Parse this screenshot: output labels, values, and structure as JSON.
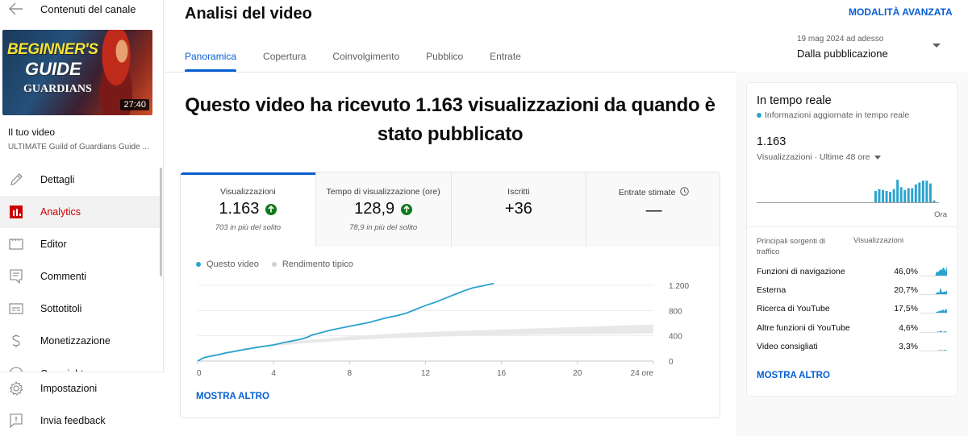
{
  "sidebar": {
    "back_label": "Contenuti del canale",
    "thumbnail": {
      "title_line1": "BEGINNER'S",
      "title_line2": "GUIDE",
      "title_line3": "GUARDIANS",
      "duration": "27:40"
    },
    "your_video_label": "Il tuo video",
    "video_title": "ULTIMATE Guild of Guardians Guide ...",
    "nav_items": [
      {
        "label": "Dettagli",
        "icon": "pencil-icon",
        "active": false
      },
      {
        "label": "Analytics",
        "icon": "analytics-icon",
        "active": true
      },
      {
        "label": "Editor",
        "icon": "editor-icon",
        "active": false
      },
      {
        "label": "Commenti",
        "icon": "comments-icon",
        "active": false
      },
      {
        "label": "Sottotitoli",
        "icon": "subtitles-icon",
        "active": false
      },
      {
        "label": "Monetizzazione",
        "icon": "dollar-icon",
        "active": false
      },
      {
        "label": "Copyright",
        "icon": "copyright-icon",
        "active": false
      }
    ],
    "bottom_items": [
      {
        "label": "Impostazioni",
        "icon": "gear-icon"
      },
      {
        "label": "Invia feedback",
        "icon": "feedback-icon"
      }
    ]
  },
  "header": {
    "title": "Analisi del video",
    "advanced_mode": "MODALITÀ AVANZATA",
    "date_range": "19 mag 2024 ad adesso",
    "date_preset": "Dalla pubblicazione"
  },
  "tabs": [
    {
      "label": "Panoramica",
      "active": true
    },
    {
      "label": "Copertura",
      "active": false
    },
    {
      "label": "Coinvolgimento",
      "active": false
    },
    {
      "label": "Pubblico",
      "active": false
    },
    {
      "label": "Entrate",
      "active": false
    }
  ],
  "headline": "Questo video ha ricevuto 1.163 visualizzazioni da quando è stato pubblicato",
  "metrics": [
    {
      "label": "Visualizzazioni",
      "value": "1.163",
      "trend": "up",
      "sub": "703 in più del solito",
      "active": true
    },
    {
      "label": "Tempo di visualizzazione (ore)",
      "value": "128,9",
      "trend": "up",
      "sub": "78,9 in più del solito",
      "active": false
    },
    {
      "label": "Iscritti",
      "value": "+36",
      "trend": null,
      "sub": "",
      "active": false
    },
    {
      "label": "Entrate stimate",
      "value": "—",
      "trend": null,
      "sub": "",
      "active": false,
      "has_clock_icon": true
    }
  ],
  "show_more": "MOSTRA ALTRO",
  "colors": {
    "accent": "#065fd4",
    "active_nav": "#cc0000",
    "series": "#2ba3cf",
    "typical_band": "#e8e8e8",
    "trend_up": "#0f7a1a"
  },
  "chart_data": {
    "type": "line",
    "title": "",
    "xlabel": "",
    "ylabel": "",
    "x_ticks": [
      "0",
      "4",
      "8",
      "12",
      "16",
      "20",
      "24 ore"
    ],
    "y_ticks": [
      "0",
      "400",
      "800",
      "1.200"
    ],
    "xlim": [
      0,
      24
    ],
    "ylim": [
      0,
      1200
    ],
    "legend": [
      "Questo video",
      "Rendimento tipico"
    ],
    "legend_position": "top-left",
    "grid": true,
    "series": [
      {
        "name": "Questo video",
        "x": [
          0,
          0.3,
          0.7,
          1,
          1.5,
          2,
          2.5,
          3,
          3.5,
          4,
          4.5,
          5,
          5.5,
          5.8,
          6,
          6.5,
          7,
          7.5,
          8,
          8.5,
          9,
          9.5,
          10,
          10.5,
          11,
          11.5,
          12,
          12.5,
          13,
          13.5,
          14,
          14.5,
          15,
          15.6
        ],
        "y": [
          0,
          50,
          80,
          95,
          130,
          155,
          185,
          210,
          235,
          255,
          290,
          320,
          350,
          380,
          410,
          450,
          490,
          520,
          550,
          580,
          610,
          650,
          690,
          720,
          760,
          820,
          880,
          930,
          990,
          1050,
          1110,
          1160,
          1190,
          1230
        ]
      },
      {
        "name": "Rendimento tipico",
        "type": "band",
        "x": [
          0,
          2,
          4,
          6,
          8,
          10,
          12,
          14,
          16,
          18,
          20,
          22,
          24
        ],
        "low": [
          0,
          160,
          240,
          290,
          330,
          360,
          380,
          400,
          410,
          420,
          425,
          430,
          440
        ],
        "high": [
          0,
          180,
          270,
          340,
          390,
          430,
          460,
          480,
          500,
          520,
          540,
          560,
          580
        ]
      }
    ]
  },
  "realtime": {
    "title": "In tempo reale",
    "subtitle": "Informazioni aggiornate in tempo reale",
    "value": "1.163",
    "metric_label": "Visualizzazioni · Ultime 48 ore",
    "bar_end_label": "Ora",
    "bars": [
      0,
      0,
      0,
      0,
      0,
      0,
      0,
      0,
      0,
      0,
      0,
      0,
      0,
      0,
      0,
      0,
      0,
      0,
      0,
      0,
      0,
      0,
      0,
      0,
      0,
      0,
      0,
      0,
      0,
      0,
      0,
      0,
      12,
      14,
      13,
      12,
      11,
      14,
      24,
      16,
      13,
      15,
      15,
      19,
      21,
      23,
      23,
      20,
      2
    ],
    "sources_header": "Principali sorgenti di traffico",
    "sources_value_header": "Visualizzazioni",
    "sources": [
      {
        "name": "Funzioni di navigazione",
        "value": "46,0%",
        "spark": [
          0,
          0,
          0,
          0,
          0,
          0,
          0,
          0,
          0,
          0,
          0,
          0,
          0,
          6,
          5,
          7,
          9,
          8,
          12,
          10,
          6,
          14
        ]
      },
      {
        "name": "Esterna",
        "value": "20,7%",
        "spark": [
          0,
          0,
          0,
          0,
          0,
          0,
          0,
          0,
          0,
          0,
          0,
          0,
          0,
          2,
          3,
          2,
          10,
          3,
          3,
          4,
          3,
          6
        ]
      },
      {
        "name": "Ricerca di YouTube",
        "value": "17,5%",
        "spark": [
          0,
          0,
          0,
          0,
          0,
          0,
          0,
          0,
          0,
          0,
          0,
          0,
          0,
          1,
          2,
          2,
          3,
          3,
          5,
          2,
          6,
          4
        ]
      },
      {
        "name": "Altre funzioni di YouTube",
        "value": "4,6%",
        "spark": [
          0,
          0,
          0,
          0,
          0,
          0,
          0,
          0,
          0,
          0,
          0,
          0,
          0,
          0,
          1,
          0,
          2,
          1,
          0,
          1,
          1,
          0
        ]
      },
      {
        "name": "Video consigliati",
        "value": "3,3%",
        "spark": [
          0,
          0,
          0,
          0,
          0,
          0,
          0,
          0,
          0,
          0,
          0,
          0,
          0,
          0,
          0,
          1,
          0,
          1,
          0,
          1,
          1,
          0
        ]
      }
    ],
    "show_more": "MOSTRA ALTRO"
  }
}
